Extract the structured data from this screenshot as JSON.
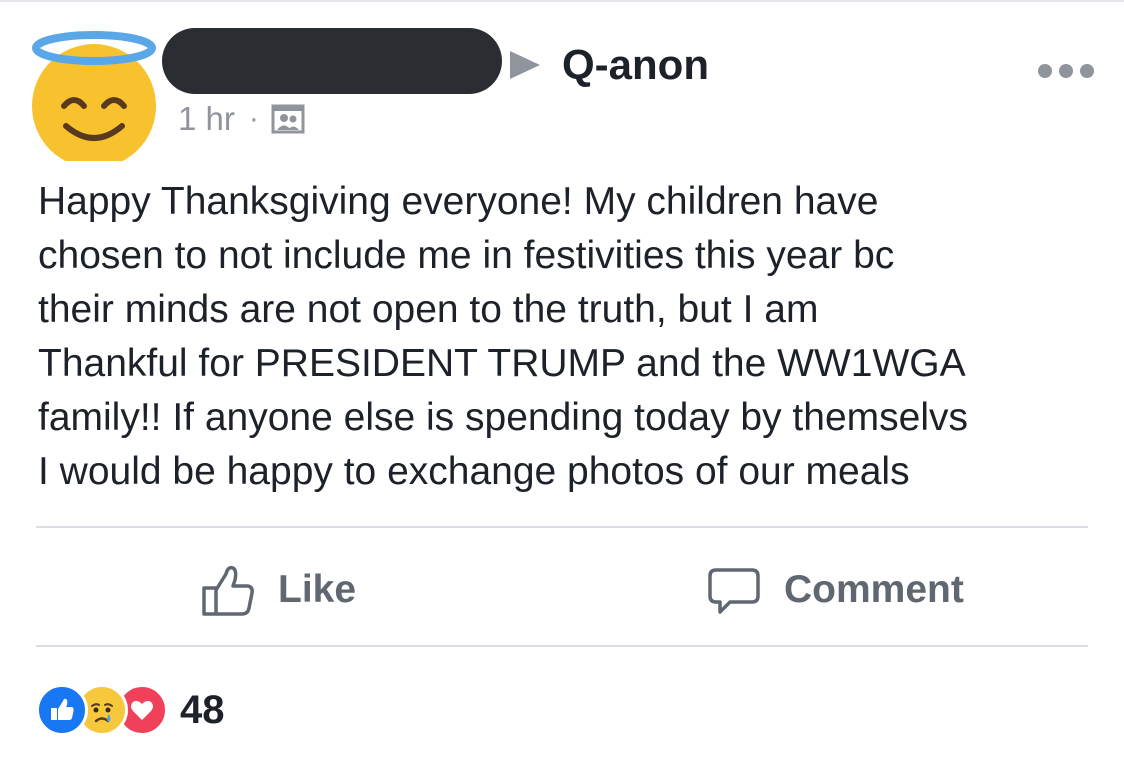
{
  "post": {
    "group_name": "Q-anon",
    "timestamp": "1 hr",
    "meta_separator": "·",
    "audience_icon": "group-audience-icon",
    "author_avatar_icon": "smiling-face-with-halo-icon",
    "author_name_redacted": true,
    "more_icon": "more-options-icon",
    "text": "Happy Thanksgiving everyone! My children have\nchosen to not include me in festivities this year bc\ntheir minds are not open to the truth, but I am\nThankful for PRESIDENT TRUMP and the WW1WGA\nfamily!! If anyone else is spending today by themselvs\nI would be happy to exchange photos of our meals"
  },
  "actions": {
    "like_label": "Like",
    "like_icon": "thumbs-up-outline-icon",
    "comment_label": "Comment",
    "comment_icon": "speech-bubble-icon"
  },
  "reactions": {
    "icons": [
      "like-reaction-icon",
      "sad-reaction-icon",
      "love-reaction-icon"
    ],
    "count": "48"
  },
  "colors": {
    "text": "#1d2129",
    "secondary_text": "#90949c",
    "action_text": "#606770",
    "like_blue": "#1877f2",
    "sad_yellow": "#f7c83b",
    "love_red": "#f0405a",
    "divider": "#dadde1",
    "redaction": "#2a2d31"
  }
}
